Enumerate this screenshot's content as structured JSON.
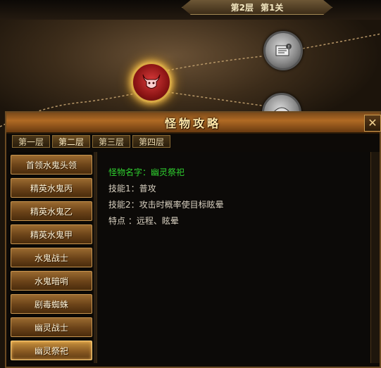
{
  "stage": {
    "floor": "第2层",
    "level": "第1关"
  },
  "map": {
    "nodes": [
      {
        "name": "active-boss-node",
        "icon": "bull-icon",
        "state": "active"
      },
      {
        "name": "locked-node-scroll",
        "icon": "scroll-icon",
        "state": "locked"
      },
      {
        "name": "locked-node-bottom",
        "icon": "monster-icon",
        "state": "locked"
      }
    ]
  },
  "panel": {
    "title": "怪物攻略",
    "close_icon": "close-icon",
    "tabs": [
      {
        "label": "第一层"
      },
      {
        "label": "第二层"
      },
      {
        "label": "第三层"
      },
      {
        "label": "第四层"
      }
    ],
    "monsters": [
      {
        "label": "首领水鬼头领"
      },
      {
        "label": "精英水鬼丙"
      },
      {
        "label": "精英水鬼乙"
      },
      {
        "label": "精英水鬼甲"
      },
      {
        "label": "水鬼战士"
      },
      {
        "label": "水鬼暗哨"
      },
      {
        "label": "剧毒蜘蛛"
      },
      {
        "label": "幽灵战士"
      },
      {
        "label": "幽灵祭祀"
      }
    ],
    "selected_monster": "幽灵祭祀",
    "detail": {
      "name_line": "怪物名字：幽灵祭祀",
      "skill1_line": "技能1：普攻",
      "skill2_line": "技能2：攻击时概率使目标眩晕",
      "trait_line": "特点  ：远程、眩晕"
    }
  },
  "colors": {
    "name_green": "#2fd02f",
    "title_gold": "#ffe7a8",
    "button_brown": "#6a4218"
  }
}
